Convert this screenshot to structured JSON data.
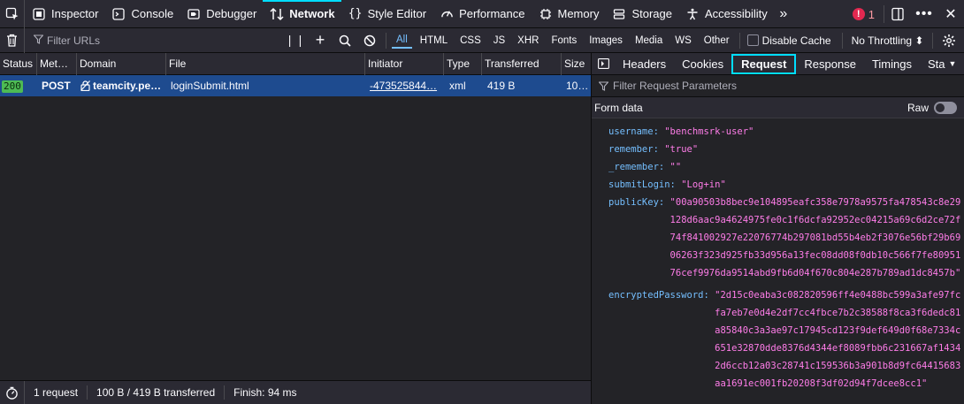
{
  "toolbar": {
    "tabs": [
      {
        "label": "Inspector",
        "icon": "inspector-icon"
      },
      {
        "label": "Console",
        "icon": "console-icon"
      },
      {
        "label": "Debugger",
        "icon": "debugger-icon"
      },
      {
        "label": "Network",
        "icon": "network-icon",
        "active": true
      },
      {
        "label": "Style Editor",
        "icon": "style-editor-icon"
      },
      {
        "label": "Performance",
        "icon": "performance-icon"
      },
      {
        "label": "Memory",
        "icon": "memory-icon"
      },
      {
        "label": "Storage",
        "icon": "storage-icon"
      },
      {
        "label": "Accessibility",
        "icon": "accessibility-icon"
      }
    ],
    "error_count": "1"
  },
  "filterbar": {
    "placeholder": "Filter URLs",
    "types": [
      "All",
      "HTML",
      "CSS",
      "JS",
      "XHR",
      "Fonts",
      "Images",
      "Media",
      "WS",
      "Other"
    ],
    "disable_cache": "Disable Cache",
    "throttling": "No Throttling ⬍"
  },
  "table": {
    "columns": [
      "Status",
      "Met…",
      "Domain",
      "File",
      "Initiator",
      "Type",
      "Transferred",
      "Size"
    ],
    "rows": [
      {
        "status": "200",
        "method": "POST",
        "domain": "teamcity.pe…",
        "file": "loginSubmit.html",
        "initiator": "-473525844…",
        "type": "xml",
        "transferred": "419 B",
        "size": "10…"
      }
    ]
  },
  "footer": {
    "requests": "1 request",
    "transferred": "100 B / 419 B transferred",
    "finish": "Finish: 94 ms"
  },
  "details": {
    "tabs": [
      "Headers",
      "Cookies",
      "Request",
      "Response",
      "Timings",
      "Sta"
    ],
    "filter_placeholder": "Filter Request Parameters",
    "form_data_label": "Form data",
    "raw_label": "Raw",
    "params": [
      {
        "key": "username:",
        "value": "\"benchmsrk-user\""
      },
      {
        "key": "remember:",
        "value": "\"true\""
      },
      {
        "key": "_remember:",
        "value": "\"\""
      },
      {
        "key": "submitLogin:",
        "value": "\"Log+in\""
      },
      {
        "key": "publicKey:",
        "value": "\"00a90503b8bec9e104895eafc358e7978a9575fa478543c8e29128d6aac9a4624975fe0c1f6dcfa92952ec04215a69c6d2ce72f74f841002927e22076774b297081bd55b4eb2f3076e56bf29b6906263f323d925fb33d956a13fec08dd08f0db10c566f7fe8095176cef9976da9514abd9fb6d04f670c804e287b789ad1dc8457b\""
      },
      {
        "key": "encryptedPassword:",
        "value": "\"2d15c0eaba3c082820596ff4e0488bc599a3afe97fcfa7eb7e0d4e2df7cc4fbce7b2c38588f8ca3f6dedc81a85840c3a3ae97c17945cd123f9def649d0f68e7334c651e32870dde8376d4344ef8089fbb6c231667af14342d6ccb12a03c28741c159536b3a901b8d9fc64415683aa1691ec001fb20208f3df02d94f7dcee8cc1\""
      }
    ]
  }
}
